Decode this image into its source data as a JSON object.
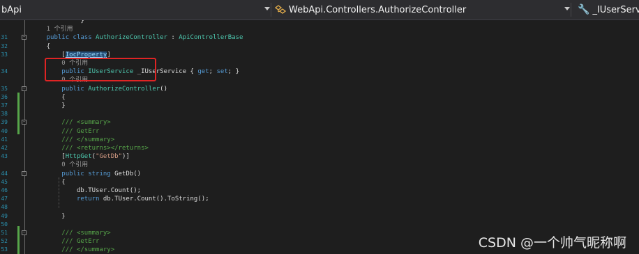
{
  "navbar": {
    "project": "bApi",
    "class_path": "WebApi.Controllers.AuthorizeController",
    "member": "_IUserServic"
  },
  "editor": {
    "lines": [
      {
        "ln": "",
        "fold": "",
        "tokens": [
          {
            "t": "pl",
            "v": "                    }"
          }
        ]
      },
      {
        "ln": "",
        "fold": "",
        "tokens": [
          {
            "t": "ref",
            "v": "           1 个引用"
          }
        ]
      },
      {
        "ln": "31",
        "fold": "-",
        "tokens": [
          {
            "t": "kw",
            "v": "           public class "
          },
          {
            "t": "ty",
            "v": "AuthorizeController"
          },
          {
            "t": "pl",
            "v": " : "
          },
          {
            "t": "ty",
            "v": "ApiControllerBase"
          }
        ]
      },
      {
        "ln": "32",
        "fold": "",
        "tokens": [
          {
            "t": "pl",
            "v": "           {"
          }
        ]
      },
      {
        "ln": "33",
        "fold": "",
        "tokens": [
          {
            "t": "pl",
            "v": "               ["
          },
          {
            "t": "sel",
            "v": "IocProperty"
          },
          {
            "t": "pl",
            "v": "]"
          }
        ]
      },
      {
        "ln": "",
        "fold": "",
        "tokens": [
          {
            "t": "ref",
            "v": "               0 个引用"
          }
        ]
      },
      {
        "ln": "34",
        "fold": "",
        "tokens": [
          {
            "t": "kw",
            "v": "               public "
          },
          {
            "t": "ty",
            "v": "IUserService"
          },
          {
            "t": "pl",
            "v": " _IUserService { "
          },
          {
            "t": "kw",
            "v": "get"
          },
          {
            "t": "pl",
            "v": "; "
          },
          {
            "t": "kw",
            "v": "set"
          },
          {
            "t": "pl",
            "v": "; }"
          }
        ]
      },
      {
        "ln": "",
        "fold": "",
        "tokens": [
          {
            "t": "ref",
            "v": "               0 个引用"
          }
        ]
      },
      {
        "ln": "35",
        "fold": "-",
        "tokens": [
          {
            "t": "kw",
            "v": "               public "
          },
          {
            "t": "ty",
            "v": "AuthorizeController"
          },
          {
            "t": "pl",
            "v": "()"
          }
        ]
      },
      {
        "ln": "36",
        "fold": "",
        "tokens": [
          {
            "t": "pl",
            "v": "               {"
          }
        ]
      },
      {
        "ln": "37",
        "fold": "",
        "tokens": [
          {
            "t": "pl",
            "v": "               }"
          }
        ]
      },
      {
        "ln": "38",
        "fold": "",
        "tokens": [
          {
            "t": "pl",
            "v": ""
          }
        ]
      },
      {
        "ln": "39",
        "fold": "-",
        "tokens": [
          {
            "t": "cm",
            "v": "               /// <summary>"
          }
        ]
      },
      {
        "ln": "40",
        "fold": "",
        "tokens": [
          {
            "t": "cm",
            "v": "               /// GetErr"
          }
        ]
      },
      {
        "ln": "41",
        "fold": "",
        "tokens": [
          {
            "t": "cm",
            "v": "               /// </summary>"
          }
        ]
      },
      {
        "ln": "42",
        "fold": "",
        "tokens": [
          {
            "t": "cm",
            "v": "               /// <returns></returns>"
          }
        ]
      },
      {
        "ln": "43",
        "fold": "",
        "tokens": [
          {
            "t": "pl",
            "v": "               ["
          },
          {
            "t": "ty",
            "v": "HttpGet"
          },
          {
            "t": "pl",
            "v": "("
          },
          {
            "t": "st",
            "v": "\"GetDb\""
          },
          {
            "t": "pl",
            "v": ")]"
          }
        ]
      },
      {
        "ln": "",
        "fold": "",
        "tokens": [
          {
            "t": "ref",
            "v": "               0 个引用"
          }
        ]
      },
      {
        "ln": "44",
        "fold": "-",
        "tokens": [
          {
            "t": "kw",
            "v": "               public string "
          },
          {
            "t": "pl",
            "v": "GetDb()"
          }
        ]
      },
      {
        "ln": "45",
        "fold": "",
        "tokens": [
          {
            "t": "pl",
            "v": "               {"
          }
        ]
      },
      {
        "ln": "46",
        "fold": "",
        "tokens": [
          {
            "t": "pl",
            "v": "                   db.TUser.Count();"
          }
        ]
      },
      {
        "ln": "47",
        "fold": "",
        "tokens": [
          {
            "t": "kw",
            "v": "                   return "
          },
          {
            "t": "pl",
            "v": "db.TUser.Count().ToString();"
          }
        ]
      },
      {
        "ln": "48",
        "fold": "",
        "tokens": [
          {
            "t": "pl",
            "v": ""
          }
        ]
      },
      {
        "ln": "49",
        "fold": "",
        "tokens": [
          {
            "t": "pl",
            "v": "               }"
          }
        ]
      },
      {
        "ln": "50",
        "fold": "",
        "tokens": [
          {
            "t": "pl",
            "v": ""
          }
        ]
      },
      {
        "ln": "51",
        "fold": "-",
        "tokens": [
          {
            "t": "cm",
            "v": "               /// <summary>"
          }
        ]
      },
      {
        "ln": "52",
        "fold": "",
        "tokens": [
          {
            "t": "cm",
            "v": "               /// GetErr"
          }
        ]
      },
      {
        "ln": "53",
        "fold": "",
        "tokens": [
          {
            "t": "cm",
            "v": "               /// </summary>"
          }
        ]
      }
    ]
  },
  "watermark": "CSDN @一个帅气昵称啊"
}
